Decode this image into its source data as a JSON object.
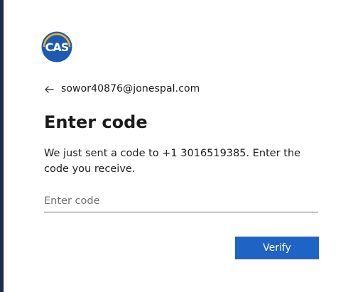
{
  "brand": {
    "logo_text": "CAS",
    "logo_icon": "cas-logo-icon",
    "colors": {
      "accent": "#1F63C5",
      "logo_blue": "#1E5AB4",
      "logo_yellow": "#F2B51C",
      "border": "#1B2B4A"
    }
  },
  "identity": {
    "back_icon": "back-arrow-icon",
    "email": "sowor40876@jonespal.com"
  },
  "page": {
    "title": "Enter code",
    "description": "We just sent a code to +1 3016519385. Enter the code you receive."
  },
  "form": {
    "code_input": {
      "placeholder": "Enter code",
      "value": ""
    },
    "verify_label": "Verify"
  }
}
